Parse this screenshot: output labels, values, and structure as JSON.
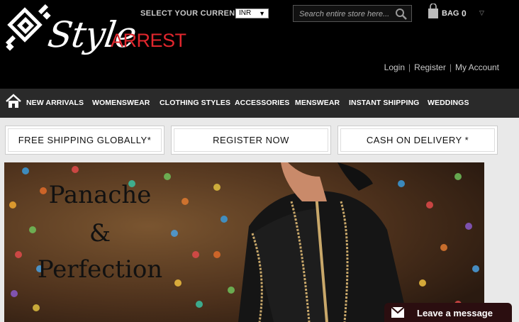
{
  "logo": {
    "script": "Style",
    "word": "ARREST"
  },
  "currency": {
    "label": "SELECT YOUR CURRENCY",
    "selected": "INR"
  },
  "search": {
    "placeholder": "Search entire store here..."
  },
  "bag": {
    "label": "BAG",
    "count": "0"
  },
  "account": {
    "login": "Login",
    "register": "Register",
    "my_account": "My Account"
  },
  "nav": {
    "items": [
      "NEW ARRIVALS",
      "WOMENSWEAR",
      "CLOTHING STYLES",
      "ACCESSORIES",
      "MENSWEAR",
      "INSTANT SHIPPING",
      "WEDDINGS"
    ]
  },
  "promos": [
    "FREE SHIPPING GLOBALLY*",
    "REGISTER NOW",
    "CASH ON DELIVERY *"
  ],
  "banner": {
    "line1": "Panache",
    "line2": "&",
    "line3": "Perfection"
  },
  "chat": {
    "label": "Leave a message"
  },
  "colors": {
    "brand_red": "#e0262d",
    "header_bg": "#000000",
    "nav_bg": "#2a2a2a",
    "chat_bg": "#2b0e10"
  }
}
